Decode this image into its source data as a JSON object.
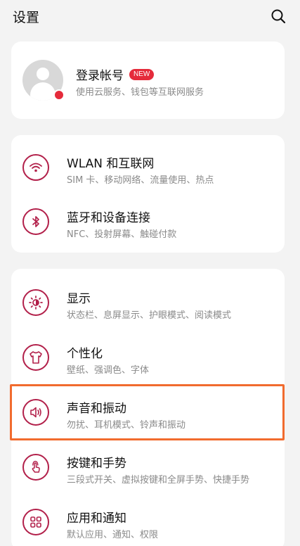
{
  "header": {
    "title": "设置"
  },
  "account": {
    "title": "登录帐号",
    "badge": "NEW",
    "subtitle": "使用云服务、钱包等互联网服务"
  },
  "network_group": [
    {
      "label": "WLAN 和互联网",
      "sub": "SIM 卡、移动网络、流量使用、热点",
      "icon": "wifi-icon"
    },
    {
      "label": "蓝牙和设备连接",
      "sub": "NFC、投射屏幕、触碰付款",
      "icon": "bluetooth-icon"
    }
  ],
  "system_group": [
    {
      "label": "显示",
      "sub": "状态栏、息屏显示、护眼模式、阅读模式",
      "icon": "sun-icon"
    },
    {
      "label": "个性化",
      "sub": "壁纸、强调色、字体",
      "icon": "tshirt-icon"
    },
    {
      "label": "声音和振动",
      "sub": "勿扰、耳机模式、铃声和振动",
      "icon": "speaker-icon"
    },
    {
      "label": "按键和手势",
      "sub": "三段式开关、虚拟按键和全屏手势、快捷手势",
      "icon": "gesture-icon"
    },
    {
      "label": "应用和通知",
      "sub": "默认应用、通知、权限",
      "icon": "apps-icon"
    }
  ],
  "colors": {
    "accent": "#b2204a",
    "badge": "#e52b3b",
    "highlight": "#f16b2e",
    "background": "#f3f3f3"
  }
}
